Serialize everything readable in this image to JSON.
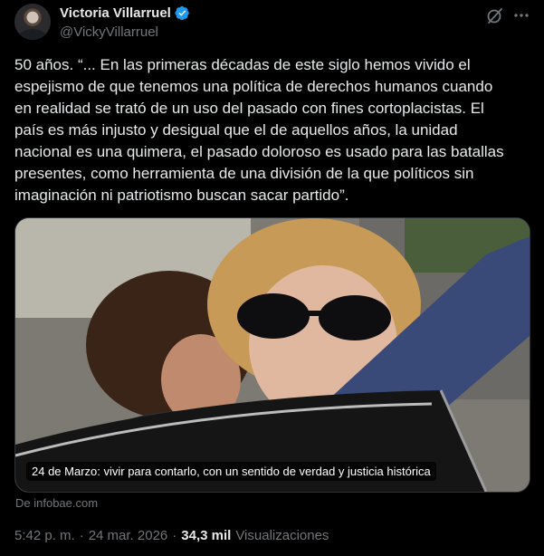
{
  "author": {
    "display_name": "Victoria Villarruel",
    "handle": "@VickyVillarruel",
    "verified": true,
    "verified_color": "#1d9bf0"
  },
  "icons": {
    "grok": "grok-icon",
    "more": "more-options-icon",
    "verified": "verified-badge-icon"
  },
  "tweet": {
    "lines": [
      "50 años. “... En las primeras décadas de este siglo hemos vivido el",
      "espejismo de que tenemos una política de derechos humanos cuando",
      "en realidad se trató de un uso del pasado con fines cortoplacistas. El",
      "país es más injusto y desigual que el de aquellos años, la unidad",
      "nacional es una quimera, el pasado doloroso es usado para las batallas",
      "presentes, como herramienta de una división de la que políticos sin",
      "imaginación ni patriotismo buscan sacar partido”."
    ]
  },
  "card": {
    "caption": "24 de Marzo: vivir para contarlo, con un sentido de verdad y justicia histórica",
    "source": "De infobae.com"
  },
  "meta": {
    "time": "5:42 p. m.",
    "separator": "·",
    "date": "24 mar. 2026",
    "views_count": "34,3 mil",
    "views_label": "Visualizaciones"
  }
}
